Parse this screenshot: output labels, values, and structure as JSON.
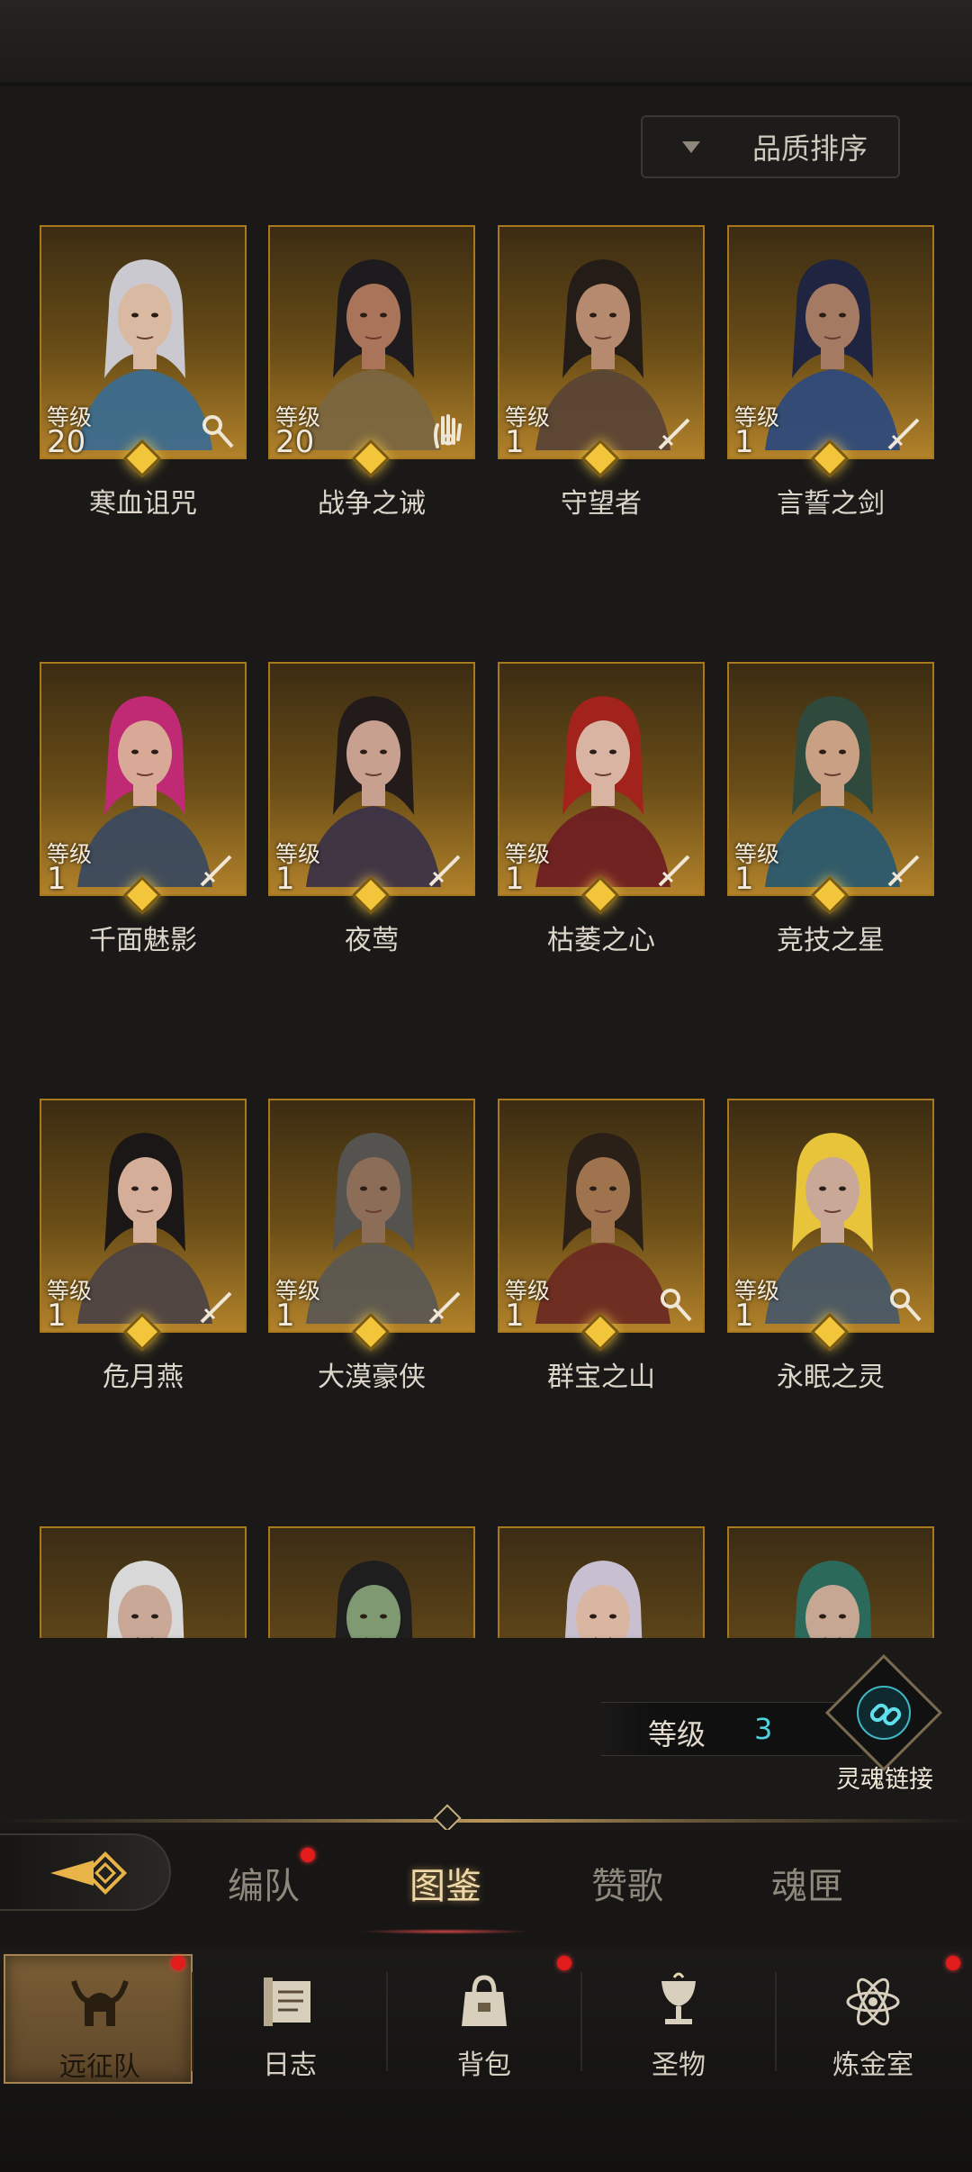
{
  "sort_button": {
    "label": "品质排序"
  },
  "heroes": [
    {
      "name": "寒血诅咒",
      "level_label": "等级",
      "level": "20",
      "class_icon": "staff-icon",
      "hair": "#c9c9cf",
      "skin": "#d9b9a2",
      "cloth": "#3c6b8e"
    },
    {
      "name": "战争之诫",
      "level_label": "等级",
      "level": "20",
      "class_icon": "palm-icon",
      "hair": "#1d1b1d",
      "skin": "#a9745a",
      "cloth": "#7a6640"
    },
    {
      "name": "守望者",
      "level_label": "等级",
      "level": "1",
      "class_icon": "sword-icon",
      "hair": "#241c17",
      "skin": "#b58a6e",
      "cloth": "#5a4535"
    },
    {
      "name": "言誓之剑",
      "level_label": "等级",
      "level": "1",
      "class_icon": "sword-icon",
      "hair": "#1f2440",
      "skin": "#a47a62",
      "cloth": "#2e4a7a"
    },
    {
      "name": "千面魅影",
      "level_label": "等级",
      "level": "1",
      "class_icon": "sword-icon",
      "hair": "#c02a74",
      "skin": "#d9a998",
      "cloth": "#3b4a5e"
    },
    {
      "name": "夜莺",
      "level_label": "等级",
      "level": "1",
      "class_icon": "sword-icon",
      "hair": "#231b1a",
      "skin": "#c7a090",
      "cloth": "#3c3346"
    },
    {
      "name": "枯萎之心",
      "level_label": "等级",
      "level": "1",
      "class_icon": "sword-icon",
      "hair": "#a2231c",
      "skin": "#d9b4a3",
      "cloth": "#6e1f22"
    },
    {
      "name": "竞技之星",
      "level_label": "等级",
      "level": "1",
      "class_icon": "sword-icon",
      "hair": "#2f4a3c",
      "skin": "#c9a084",
      "cloth": "#2b5a6e"
    },
    {
      "name": "危月燕",
      "level_label": "等级",
      "level": "1",
      "class_icon": "sword-icon",
      "hair": "#1c1717",
      "skin": "#d4ae98",
      "cloth": "#4d4343"
    },
    {
      "name": "大漠豪侠",
      "level_label": "等级",
      "level": "1",
      "class_icon": "sword-icon",
      "hair": "#55534f",
      "skin": "#8c6d58",
      "cloth": "#5c5852"
    },
    {
      "name": "群宝之山",
      "level_label": "等级",
      "level": "1",
      "class_icon": "staff-icon",
      "hair": "#2a2018",
      "skin": "#a0734f",
      "cloth": "#6b2a22"
    },
    {
      "name": "永眠之灵",
      "level_label": "等级",
      "level": "1",
      "class_icon": "staff-icon",
      "hair": "#e8c43a",
      "skin": "#c9a898",
      "cloth": "#4a5866"
    }
  ],
  "partial_heroes": [
    {
      "hair": "#d8d8d8",
      "skin": "#c9a898"
    },
    {
      "hair": "#1e1e1e",
      "skin": "#7f9a72"
    },
    {
      "hair": "#c8bfd0",
      "skin": "#d9b6a2"
    },
    {
      "hair": "#2b6a5a",
      "skin": "#c5a794"
    }
  ],
  "level_panel": {
    "label": "等级",
    "value": "3"
  },
  "soul_link": {
    "label": "灵魂链接"
  },
  "tabs": [
    {
      "label": "编队",
      "active": false,
      "badge": true
    },
    {
      "label": "图鉴",
      "active": true,
      "badge": false
    },
    {
      "label": "赞歌",
      "active": false,
      "badge": false
    },
    {
      "label": "魂匣",
      "active": false,
      "badge": false
    }
  ],
  "nav": [
    {
      "label": "远征队",
      "icon": "helmet-icon",
      "active": true,
      "badge": true
    },
    {
      "label": "日志",
      "icon": "scroll-icon",
      "active": false,
      "badge": false
    },
    {
      "label": "背包",
      "icon": "bag-icon",
      "active": false,
      "badge": true
    },
    {
      "label": "圣物",
      "icon": "chalice-icon",
      "active": false,
      "badge": false
    },
    {
      "label": "炼金室",
      "icon": "alchemy-icon",
      "active": false,
      "badge": true
    }
  ],
  "colors": {
    "gold": "#a9781c",
    "accent_cyan": "#4fd3e0",
    "badge_red": "#e21b1b"
  }
}
